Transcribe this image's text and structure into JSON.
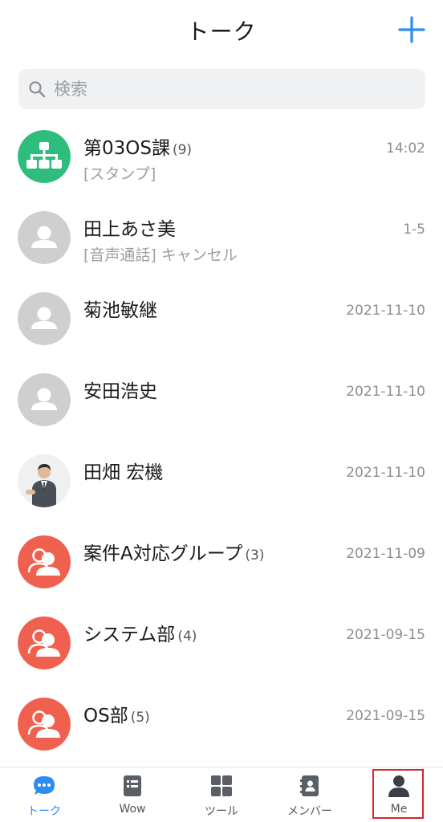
{
  "header": {
    "title": "トーク"
  },
  "search": {
    "placeholder": "検索"
  },
  "colors": {
    "accent": "#2d8cf0",
    "group_green": "#2fbd7e",
    "group_red": "#f0604f",
    "default_avatar": "#cfcfcf",
    "highlight_box": "#d9242a"
  },
  "conversations": [
    {
      "name": "第03OS課",
      "count": "(9)",
      "preview": "[スタンプ]",
      "time": "14:02",
      "avatar_icon": "org-chart-icon"
    },
    {
      "name": "田上あさ美",
      "count": "",
      "preview": "[音声通話] キャンセル",
      "time": "1-5",
      "avatar_icon": "person-icon"
    },
    {
      "name": "菊池敏継",
      "count": "",
      "preview": "",
      "time": "2021-11-10",
      "avatar_icon": "person-icon"
    },
    {
      "name": "安田浩史",
      "count": "",
      "preview": "",
      "time": "2021-11-10",
      "avatar_icon": "person-icon"
    },
    {
      "name": "田畑 宏機",
      "count": "",
      "preview": "",
      "time": "2021-11-10",
      "avatar_icon": "photo-avatar"
    },
    {
      "name": "案件A対応グループ",
      "count": "(3)",
      "preview": "",
      "time": "2021-11-09",
      "avatar_icon": "group-icon"
    },
    {
      "name": "システム部",
      "count": "(4)",
      "preview": "",
      "time": "2021-09-15",
      "avatar_icon": "group-icon"
    },
    {
      "name": "OS部",
      "count": "(5)",
      "preview": "",
      "time": "2021-09-15",
      "avatar_icon": "group-icon"
    }
  ],
  "nav": {
    "talk": "トーク",
    "wow": "Wow",
    "tools": "ツール",
    "members": "メンバー",
    "me": "Me"
  }
}
